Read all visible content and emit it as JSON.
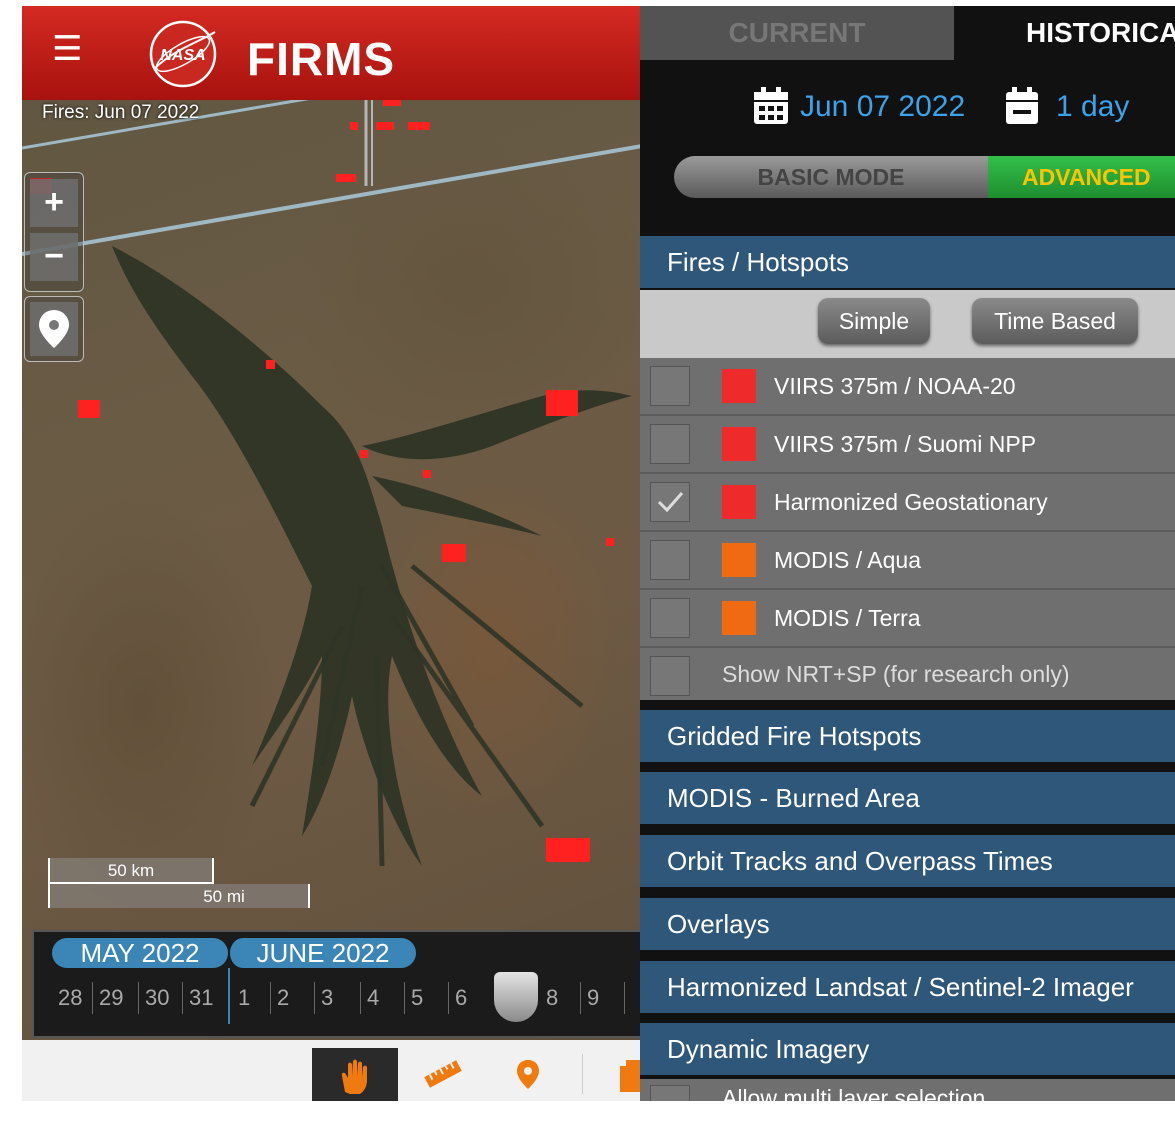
{
  "header": {
    "brand": "FIRMS",
    "logo_text": "NASA"
  },
  "map": {
    "fires_label": "Fires: Jun 07 2022"
  },
  "zoom": {
    "in": "+",
    "out": "−"
  },
  "scale": {
    "km": "50 km",
    "mi": "50 mi"
  },
  "timeline": {
    "months": [
      "MAY 2022",
      "JUNE 2022"
    ],
    "days": [
      "28",
      "29",
      "30",
      "31",
      "1",
      "2",
      "3",
      "4",
      "5",
      "6",
      "8",
      "9"
    ]
  },
  "panel": {
    "tabs": [
      "CURRENT",
      "HISTORICA"
    ],
    "date": "Jun 07 2022",
    "range": "1 day",
    "mode_basic": "BASIC MODE",
    "mode_advanced": "ADVANCED",
    "sections": {
      "fires": "Fires / Hotspots",
      "gridded": "Gridded Fire Hotspots",
      "burned": "MODIS - Burned Area",
      "orbit": "Orbit Tracks and Overpass Times",
      "overlays": "Overlays",
      "landsat": "Harmonized Landsat / Sentinel-2 Imager",
      "dynamic": "Dynamic Imagery"
    },
    "subtoggle": {
      "simple": "Simple",
      "time_based": "Time Based"
    },
    "layers": [
      {
        "label": "VIIRS 375m / NOAA-20",
        "color": "#ef2a2a",
        "checked": false
      },
      {
        "label": "VIIRS 375m / Suomi NPP",
        "color": "#ef2a2a",
        "checked": false
      },
      {
        "label": "Harmonized Geostationary",
        "color": "#ef2a2a",
        "checked": true
      },
      {
        "label": "MODIS / Aqua",
        "color": "#ef6a10",
        "checked": false
      },
      {
        "label": "MODIS / Terra",
        "color": "#ef6a10",
        "checked": false
      }
    ],
    "research": "Show NRT+SP (for research only)",
    "multi_layer": "Allow multi layer selection"
  }
}
